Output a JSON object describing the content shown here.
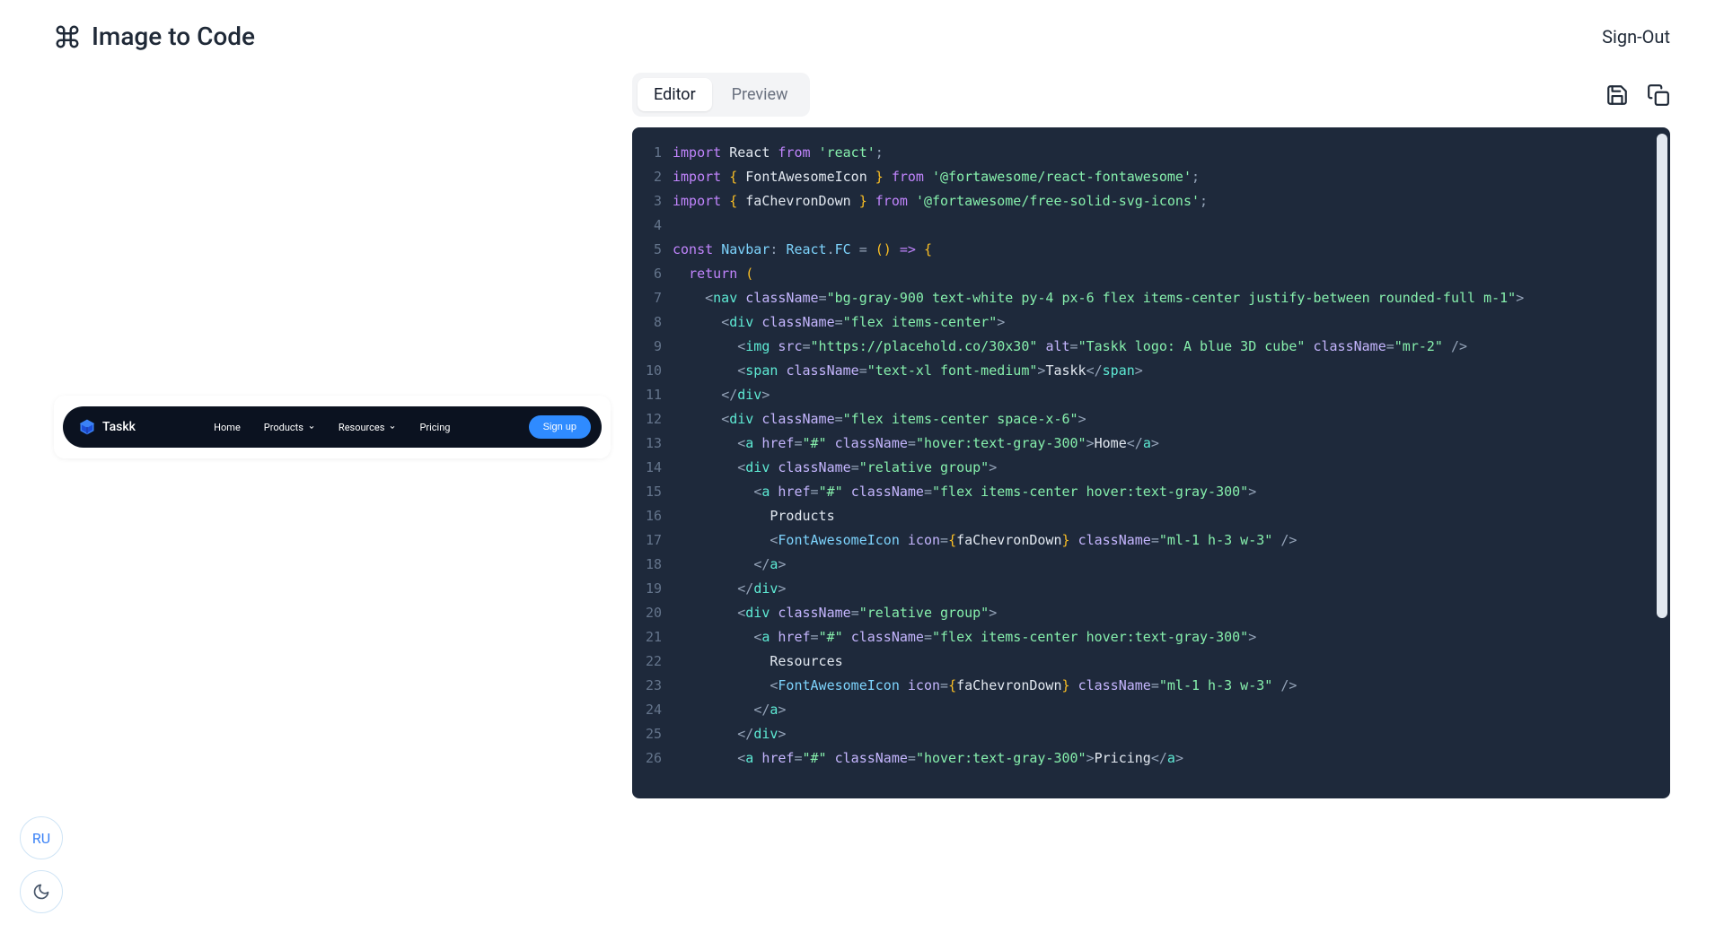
{
  "header": {
    "title": "Image to Code",
    "signout": "Sign-Out"
  },
  "tabs": {
    "editor": "Editor",
    "preview": "Preview"
  },
  "preview_nav": {
    "brand": "Taskk",
    "links": {
      "home": "Home",
      "products": "Products",
      "resources": "Resources",
      "pricing": "Pricing"
    },
    "signup": "Sign up"
  },
  "float": {
    "avatar": "RU"
  },
  "code": {
    "lines": [
      {
        "n": 1,
        "t": "import",
        "segs": [
          [
            "kw",
            "import"
          ],
          [
            "",
            ""
          ],
          [
            "id",
            " React "
          ],
          [
            "kw",
            "from"
          ],
          [
            "",
            " "
          ],
          [
            "str",
            "'react'"
          ],
          [
            "punc",
            ";"
          ]
        ]
      },
      {
        "n": 2,
        "t": "import",
        "segs": [
          [
            "kw",
            "import"
          ],
          [
            "",
            " "
          ],
          [
            "brace",
            "{"
          ],
          [
            "id",
            " FontAwesomeIcon "
          ],
          [
            "brace",
            "}"
          ],
          [
            "",
            " "
          ],
          [
            "kw",
            "from"
          ],
          [
            "",
            " "
          ],
          [
            "str",
            "'@fortawesome/react-fontawesome'"
          ],
          [
            "punc",
            ";"
          ]
        ]
      },
      {
        "n": 3,
        "t": "import",
        "segs": [
          [
            "kw",
            "import"
          ],
          [
            "",
            " "
          ],
          [
            "brace",
            "{"
          ],
          [
            "id",
            " faChevronDown "
          ],
          [
            "brace",
            "}"
          ],
          [
            "",
            " "
          ],
          [
            "kw",
            "from"
          ],
          [
            "",
            " "
          ],
          [
            "str",
            "'@fortawesome/free-solid-svg-icons'"
          ],
          [
            "punc",
            ";"
          ]
        ]
      },
      {
        "n": 4,
        "t": "",
        "segs": [
          [
            "",
            ""
          ]
        ]
      },
      {
        "n": 5,
        "t": "const",
        "segs": [
          [
            "kw",
            "const"
          ],
          [
            "",
            " "
          ],
          [
            "type",
            "Navbar"
          ],
          [
            "punc",
            ": "
          ],
          [
            "type",
            "React"
          ],
          [
            "punc",
            "."
          ],
          [
            "type",
            "FC"
          ],
          [
            "punc",
            " = "
          ],
          [
            "brace",
            "()"
          ],
          [
            "punc",
            " "
          ],
          [
            "kw",
            "=>"
          ],
          [
            "punc",
            " "
          ],
          [
            "brace",
            "{"
          ]
        ]
      },
      {
        "n": 6,
        "t": "  return",
        "segs": [
          [
            "",
            "  "
          ],
          [
            "kw",
            "return"
          ],
          [
            "punc",
            " "
          ],
          [
            "brace",
            "("
          ]
        ]
      },
      {
        "n": 7,
        "t": "    nav",
        "segs": [
          [
            "",
            "    "
          ],
          [
            "punc",
            "<"
          ],
          [
            "el",
            "nav"
          ],
          [
            "",
            " "
          ],
          [
            "attr",
            "className"
          ],
          [
            "punc",
            "="
          ],
          [
            "val",
            "\"bg-gray-900 text-white py-4 px-6 flex items-center justify-between rounded-full m-1\""
          ],
          [
            "punc",
            ">"
          ]
        ]
      },
      {
        "n": 8,
        "t": "      div",
        "segs": [
          [
            "",
            "      "
          ],
          [
            "punc",
            "<"
          ],
          [
            "el",
            "div"
          ],
          [
            "",
            " "
          ],
          [
            "attr",
            "className"
          ],
          [
            "punc",
            "="
          ],
          [
            "val",
            "\"flex items-center\""
          ],
          [
            "punc",
            ">"
          ]
        ]
      },
      {
        "n": 9,
        "t": "        img",
        "segs": [
          [
            "",
            "        "
          ],
          [
            "punc",
            "<"
          ],
          [
            "el",
            "img"
          ],
          [
            "",
            " "
          ],
          [
            "attr",
            "src"
          ],
          [
            "punc",
            "="
          ],
          [
            "val",
            "\"https://placehold.co/30x30\""
          ],
          [
            "",
            " "
          ],
          [
            "attr",
            "alt"
          ],
          [
            "punc",
            "="
          ],
          [
            "val",
            "\"Taskk logo: A blue 3D cube\""
          ],
          [
            "",
            " "
          ],
          [
            "attr",
            "className"
          ],
          [
            "punc",
            "="
          ],
          [
            "val",
            "\"mr-2\""
          ],
          [
            "punc",
            " />"
          ]
        ]
      },
      {
        "n": 10,
        "t": "        span",
        "segs": [
          [
            "",
            "        "
          ],
          [
            "punc",
            "<"
          ],
          [
            "el",
            "span"
          ],
          [
            "",
            " "
          ],
          [
            "attr",
            "className"
          ],
          [
            "punc",
            "="
          ],
          [
            "val",
            "\"text-xl font-medium\""
          ],
          [
            "punc",
            ">"
          ],
          [
            "text",
            "Taskk"
          ],
          [
            "punc",
            "</"
          ],
          [
            "el",
            "span"
          ],
          [
            "punc",
            ">"
          ]
        ]
      },
      {
        "n": 11,
        "t": "      /div",
        "segs": [
          [
            "",
            "      "
          ],
          [
            "punc",
            "</"
          ],
          [
            "el",
            "div"
          ],
          [
            "punc",
            ">"
          ]
        ]
      },
      {
        "n": 12,
        "t": "      div",
        "segs": [
          [
            "",
            "      "
          ],
          [
            "punc",
            "<"
          ],
          [
            "el",
            "div"
          ],
          [
            "",
            " "
          ],
          [
            "attr",
            "className"
          ],
          [
            "punc",
            "="
          ],
          [
            "val",
            "\"flex items-center space-x-6\""
          ],
          [
            "punc",
            ">"
          ]
        ]
      },
      {
        "n": 13,
        "t": "        a",
        "segs": [
          [
            "",
            "        "
          ],
          [
            "punc",
            "<"
          ],
          [
            "el",
            "a"
          ],
          [
            "",
            " "
          ],
          [
            "attr",
            "href"
          ],
          [
            "punc",
            "="
          ],
          [
            "val",
            "\"#\""
          ],
          [
            "",
            " "
          ],
          [
            "attr",
            "className"
          ],
          [
            "punc",
            "="
          ],
          [
            "val",
            "\"hover:text-gray-300\""
          ],
          [
            "punc",
            ">"
          ],
          [
            "text",
            "Home"
          ],
          [
            "punc",
            "</"
          ],
          [
            "el",
            "a"
          ],
          [
            "punc",
            ">"
          ]
        ]
      },
      {
        "n": 14,
        "t": "        div",
        "segs": [
          [
            "",
            "        "
          ],
          [
            "punc",
            "<"
          ],
          [
            "el",
            "div"
          ],
          [
            "",
            " "
          ],
          [
            "attr",
            "className"
          ],
          [
            "punc",
            "="
          ],
          [
            "val",
            "\"relative group\""
          ],
          [
            "punc",
            ">"
          ]
        ]
      },
      {
        "n": 15,
        "t": "          a",
        "segs": [
          [
            "",
            "          "
          ],
          [
            "punc",
            "<"
          ],
          [
            "el",
            "a"
          ],
          [
            "",
            " "
          ],
          [
            "attr",
            "href"
          ],
          [
            "punc",
            "="
          ],
          [
            "val",
            "\"#\""
          ],
          [
            "",
            " "
          ],
          [
            "attr",
            "className"
          ],
          [
            "punc",
            "="
          ],
          [
            "val",
            "\"flex items-center hover:text-gray-300\""
          ],
          [
            "punc",
            ">"
          ]
        ]
      },
      {
        "n": 16,
        "t": "            Products",
        "segs": [
          [
            "",
            "            "
          ],
          [
            "text",
            "Products"
          ]
        ]
      },
      {
        "n": 17,
        "t": "            FA",
        "segs": [
          [
            "",
            "            "
          ],
          [
            "punc",
            "<"
          ],
          [
            "type",
            "FontAwesomeIcon"
          ],
          [
            "",
            " "
          ],
          [
            "attr",
            "icon"
          ],
          [
            "punc",
            "="
          ],
          [
            "brace",
            "{"
          ],
          [
            "id",
            "faChevronDown"
          ],
          [
            "brace",
            "}"
          ],
          [
            "",
            " "
          ],
          [
            "attr",
            "className"
          ],
          [
            "punc",
            "="
          ],
          [
            "val",
            "\"ml-1 h-3 w-3\""
          ],
          [
            "punc",
            " />"
          ]
        ]
      },
      {
        "n": 18,
        "t": "          /a",
        "segs": [
          [
            "",
            "          "
          ],
          [
            "punc",
            "</"
          ],
          [
            "el",
            "a"
          ],
          [
            "punc",
            ">"
          ]
        ]
      },
      {
        "n": 19,
        "t": "        /div",
        "segs": [
          [
            "",
            "        "
          ],
          [
            "punc",
            "</"
          ],
          [
            "el",
            "div"
          ],
          [
            "punc",
            ">"
          ]
        ]
      },
      {
        "n": 20,
        "t": "        div",
        "segs": [
          [
            "",
            "        "
          ],
          [
            "punc",
            "<"
          ],
          [
            "el",
            "div"
          ],
          [
            "",
            " "
          ],
          [
            "attr",
            "className"
          ],
          [
            "punc",
            "="
          ],
          [
            "val",
            "\"relative group\""
          ],
          [
            "punc",
            ">"
          ]
        ]
      },
      {
        "n": 21,
        "t": "          a",
        "segs": [
          [
            "",
            "          "
          ],
          [
            "punc",
            "<"
          ],
          [
            "el",
            "a"
          ],
          [
            "",
            " "
          ],
          [
            "attr",
            "href"
          ],
          [
            "punc",
            "="
          ],
          [
            "val",
            "\"#\""
          ],
          [
            "",
            " "
          ],
          [
            "attr",
            "className"
          ],
          [
            "punc",
            "="
          ],
          [
            "val",
            "\"flex items-center hover:text-gray-300\""
          ],
          [
            "punc",
            ">"
          ]
        ]
      },
      {
        "n": 22,
        "t": "            Resources",
        "segs": [
          [
            "",
            "            "
          ],
          [
            "text",
            "Resources"
          ]
        ]
      },
      {
        "n": 23,
        "t": "            FA",
        "segs": [
          [
            "",
            "            "
          ],
          [
            "punc",
            "<"
          ],
          [
            "type",
            "FontAwesomeIcon"
          ],
          [
            "",
            " "
          ],
          [
            "attr",
            "icon"
          ],
          [
            "punc",
            "="
          ],
          [
            "brace",
            "{"
          ],
          [
            "id",
            "faChevronDown"
          ],
          [
            "brace",
            "}"
          ],
          [
            "",
            " "
          ],
          [
            "attr",
            "className"
          ],
          [
            "punc",
            "="
          ],
          [
            "val",
            "\"ml-1 h-3 w-3\""
          ],
          [
            "punc",
            " />"
          ]
        ]
      },
      {
        "n": 24,
        "t": "          /a",
        "segs": [
          [
            "",
            "          "
          ],
          [
            "punc",
            "</"
          ],
          [
            "el",
            "a"
          ],
          [
            "punc",
            ">"
          ]
        ]
      },
      {
        "n": 25,
        "t": "        /div",
        "segs": [
          [
            "",
            "        "
          ],
          [
            "punc",
            "</"
          ],
          [
            "el",
            "div"
          ],
          [
            "punc",
            ">"
          ]
        ]
      },
      {
        "n": 26,
        "t": "        a",
        "segs": [
          [
            "",
            "        "
          ],
          [
            "punc",
            "<"
          ],
          [
            "el",
            "a"
          ],
          [
            "",
            " "
          ],
          [
            "attr",
            "href"
          ],
          [
            "punc",
            "="
          ],
          [
            "val",
            "\"#\""
          ],
          [
            "",
            " "
          ],
          [
            "attr",
            "className"
          ],
          [
            "punc",
            "="
          ],
          [
            "val",
            "\"hover:text-gray-300\""
          ],
          [
            "punc",
            ">"
          ],
          [
            "text",
            "Pricing"
          ],
          [
            "punc",
            "</"
          ],
          [
            "el",
            "a"
          ],
          [
            "punc",
            ">"
          ]
        ]
      }
    ]
  }
}
